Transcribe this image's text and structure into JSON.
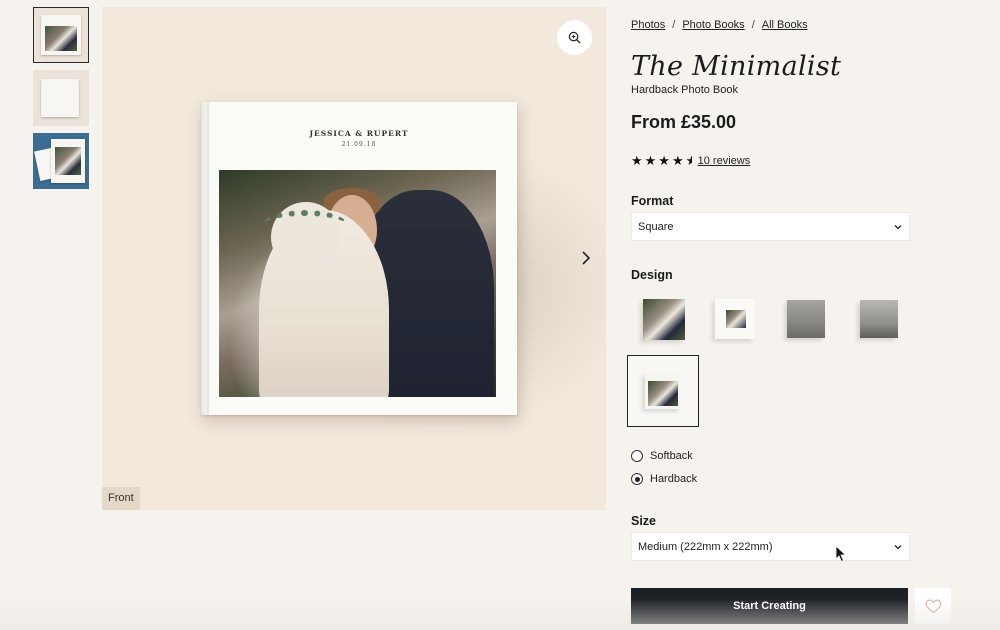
{
  "thumbnails": [
    {
      "name": "front-thumbnail",
      "selected": true
    },
    {
      "name": "blank-page-thumbnail",
      "selected": false
    },
    {
      "name": "spread-thumbnail",
      "selected": false
    }
  ],
  "stage": {
    "cover_title": "JESSICA & RUPERT",
    "cover_date": "21.09.18",
    "view_label": "Front",
    "zoom_icon": "zoom-in-icon",
    "next_icon": "chevron-right-icon"
  },
  "breadcrumb": {
    "items": [
      "Photos",
      "Photo Books",
      "All Books"
    ],
    "separator": "/"
  },
  "product": {
    "title": "The Minimalist",
    "subtitle": "Hardback Photo Book",
    "price": "From £35.00",
    "stars": "★★★★",
    "half_star": "½",
    "reviews": "10 reviews",
    "rating": 4.5
  },
  "format": {
    "label": "Format",
    "value": "Square"
  },
  "design": {
    "label": "Design",
    "options": [
      "photo-cover",
      "minimal-white",
      "grey-landscape",
      "grey-bridge",
      "framed-photo"
    ],
    "selected_index": 4
  },
  "binding": {
    "options": [
      "Softback",
      "Hardback"
    ],
    "selected": "Hardback"
  },
  "size": {
    "label": "Size",
    "value": "Medium (222mm x 222mm)"
  },
  "actions": {
    "start_label": "Start Creating",
    "wishlist_icon": "heart-icon"
  },
  "colors": {
    "background": "#f6f3ef",
    "stage": "#f2e8dc",
    "cta": "#1d2025",
    "heart": "#d9b9a2"
  }
}
